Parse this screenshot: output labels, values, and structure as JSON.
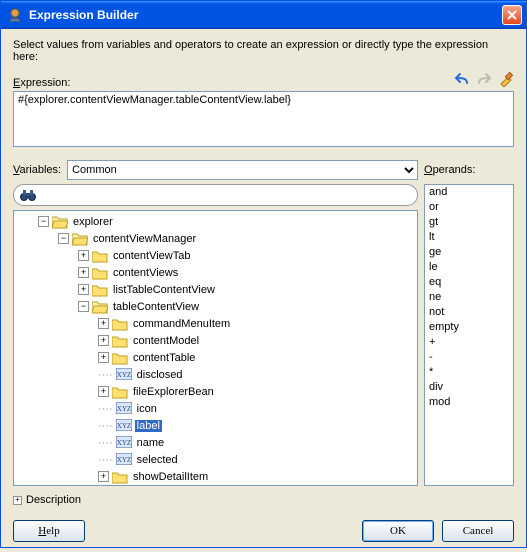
{
  "title": "Expression Builder",
  "instruction": "Select values from variables and operators to create an expression or directly type the expression here:",
  "labels": {
    "expression": "Expression:",
    "variables": "Variables:",
    "operands": "Operands:",
    "description": "Description"
  },
  "expression_value": "#{explorer.contentViewManager.tableContentView.label}",
  "variables_select": {
    "selected": "Common",
    "options": [
      "Common"
    ]
  },
  "tree": {
    "explorer": "explorer",
    "contentViewManager": "contentViewManager",
    "contentViewTab": "contentViewTab",
    "contentViews": "contentViews",
    "listTableContentView": "listTableContentView",
    "tableContentView": "tableContentView",
    "commandMenuItem": "commandMenuItem",
    "contentModel": "contentModel",
    "contentTable": "contentTable",
    "disclosed": "disclosed",
    "fileExplorerBean": "fileExplorerBean",
    "icon": "icon",
    "label": "label",
    "name": "name",
    "selected": "selected",
    "showDetailItem": "showDetailItem"
  },
  "operands": [
    "and",
    "or",
    "gt",
    "lt",
    "ge",
    "le",
    "eq",
    "ne",
    "not",
    "empty",
    "+",
    "-",
    "*",
    "div",
    "mod"
  ],
  "buttons": {
    "help": "Help",
    "ok": "OK",
    "cancel": "Cancel"
  }
}
